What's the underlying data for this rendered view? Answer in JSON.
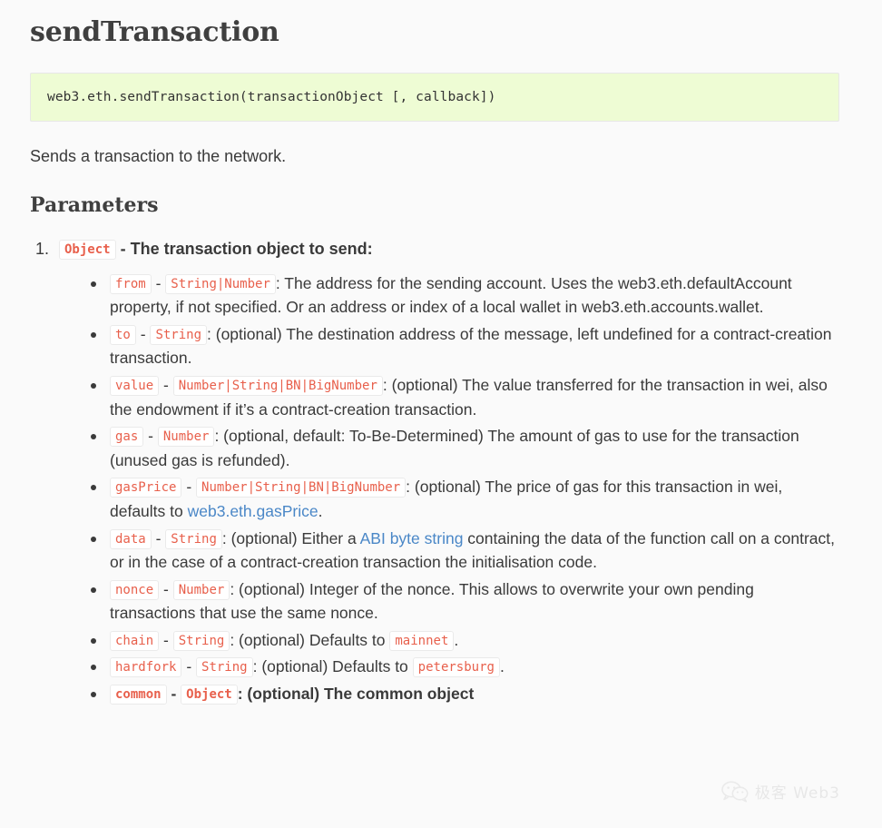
{
  "title": "sendTransaction",
  "code_block": "web3.eth.sendTransaction(transactionObject [, callback])",
  "lead": "Sends a transaction to the network.",
  "section_title": "Parameters",
  "param_item": {
    "type": "Object",
    "dash": "-",
    "description": "The transaction object to send:"
  },
  "sub_params": [
    {
      "name": "from",
      "dash": "-",
      "type": "String|Number",
      "text": ": The address for the sending account. Uses the web3.eth.defaultAccount property, if not specified. Or an address or index of a local wallet in web3.eth.accounts.wallet."
    },
    {
      "name": "to",
      "dash": "-",
      "type": "String",
      "text": ": (optional) The destination address of the message, left undefined for a contract-creation transaction."
    },
    {
      "name": "value",
      "dash": "-",
      "type": "Number|String|BN|BigNumber",
      "text": ": (optional) The value transferred for the transaction in wei, also the endowment if it’s a contract-creation transaction."
    },
    {
      "name": "gas",
      "dash": "-",
      "type": "Number",
      "text": ": (optional, default: To-Be-Determined) The amount of gas to use for the transaction (unused gas is refunded)."
    },
    {
      "name": "gasPrice",
      "dash": "-",
      "type": "Number|String|BN|BigNumber",
      "text_before": ": (optional) The price of gas for this transaction in wei, defaults to ",
      "link": "web3.eth.gasPrice",
      "text_after": "."
    },
    {
      "name": "data",
      "dash": "-",
      "type": "String",
      "text_before": ": (optional) Either a ",
      "link": "ABI byte string",
      "text_after": " containing the data of the function call on a contract, or in the case of a contract-creation transaction the initialisation code."
    },
    {
      "name": "nonce",
      "dash": "-",
      "type": "Number",
      "text": ": (optional) Integer of the nonce. This allows to overwrite your own pending transactions that use the same nonce."
    },
    {
      "name": "chain",
      "dash": "-",
      "type": "String",
      "text_before": ": (optional) Defaults to ",
      "code_value": "mainnet",
      "text_after": "."
    },
    {
      "name": "hardfork",
      "dash": "-",
      "type": "String",
      "text_before": ": (optional) Defaults to ",
      "code_value": "petersburg",
      "text_after": "."
    },
    {
      "name": "common",
      "dash": "-",
      "type": "Object",
      "text": ": (optional) The common object",
      "bold": true
    }
  ],
  "watermark": {
    "icon": "wechat-icon",
    "text": "极客 Web3"
  },
  "colors": {
    "code_block_bg": "#eefcd4",
    "inline_code_text": "#e8604c",
    "link": "#4a87c7",
    "body_text": "#3a3a3a",
    "page_bg": "#fafafa"
  }
}
